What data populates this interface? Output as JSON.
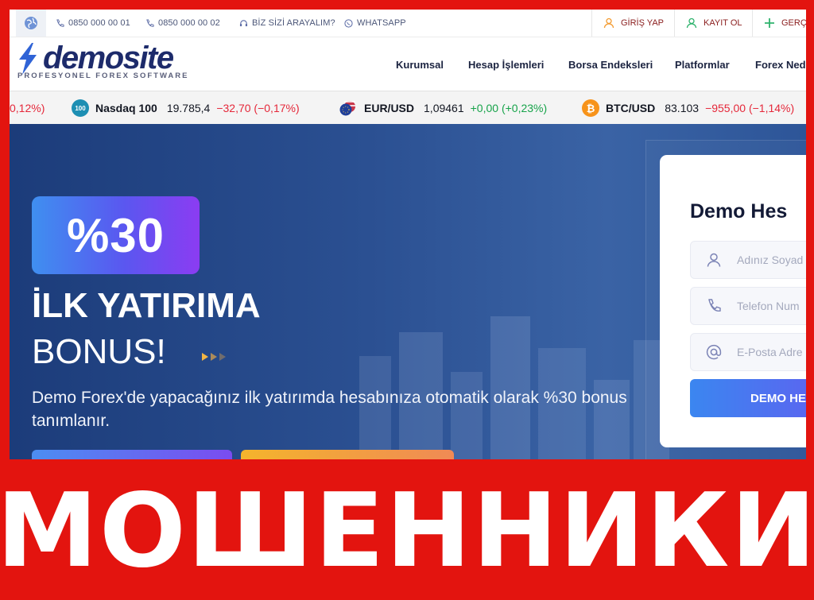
{
  "topbar": {
    "phone1": "0850 000 00 01",
    "phone2": "0850 000 00 02",
    "callback": "BİZ SİZİ ARAYALIM?",
    "whatsapp": "WHATSAPP",
    "login": "GİRİŞ YAP",
    "register": "KAYIT OL",
    "real": "GERÇ"
  },
  "logo": {
    "word": "demosite",
    "tagline": "PROFESYONEL FOREX SOFTWARE"
  },
  "nav": {
    "items": [
      "Kurumsal",
      "Hesap İşlemleri",
      "Borsa Endeksleri",
      "Platformlar",
      "Forex Nedi"
    ]
  },
  "ticker": {
    "partial_change": "0,12%)",
    "items": [
      {
        "icon_text": "100",
        "name": "Nasdaq 100",
        "price": "19.785,4",
        "change": "−32,70 (−0,17%)"
      },
      {
        "icon_text": "",
        "name": "EUR/USD",
        "price": "1,09461",
        "change": "+0,00 (+0,23%)"
      },
      {
        "icon_text": "₿",
        "name": "BTC/USD",
        "price": "83.103",
        "change": "−955,00 (−1,14%)"
      }
    ]
  },
  "hero": {
    "badge": "%30",
    "title": "İLK YATIRIMA",
    "subtitle": "BONUS!",
    "description": "Demo Forex'de yapacağınız ilk yatırımda hesabınıza otomatik olarak %30 bonus tanımlanır."
  },
  "form": {
    "title": "Demo Hes",
    "name_placeholder": "Adınız Soyad",
    "phone_placeholder": "Telefon Num",
    "email_placeholder": "E-Posta Adre",
    "button": "DEMO HE"
  },
  "stamp": "МОШЕННИКИ",
  "colors": {
    "frame_red": "#e3140f",
    "brand_navy": "#1d2b6b",
    "accent_blue": "#3b86f0",
    "negative": "#e5283a",
    "positive": "#17a34a"
  }
}
